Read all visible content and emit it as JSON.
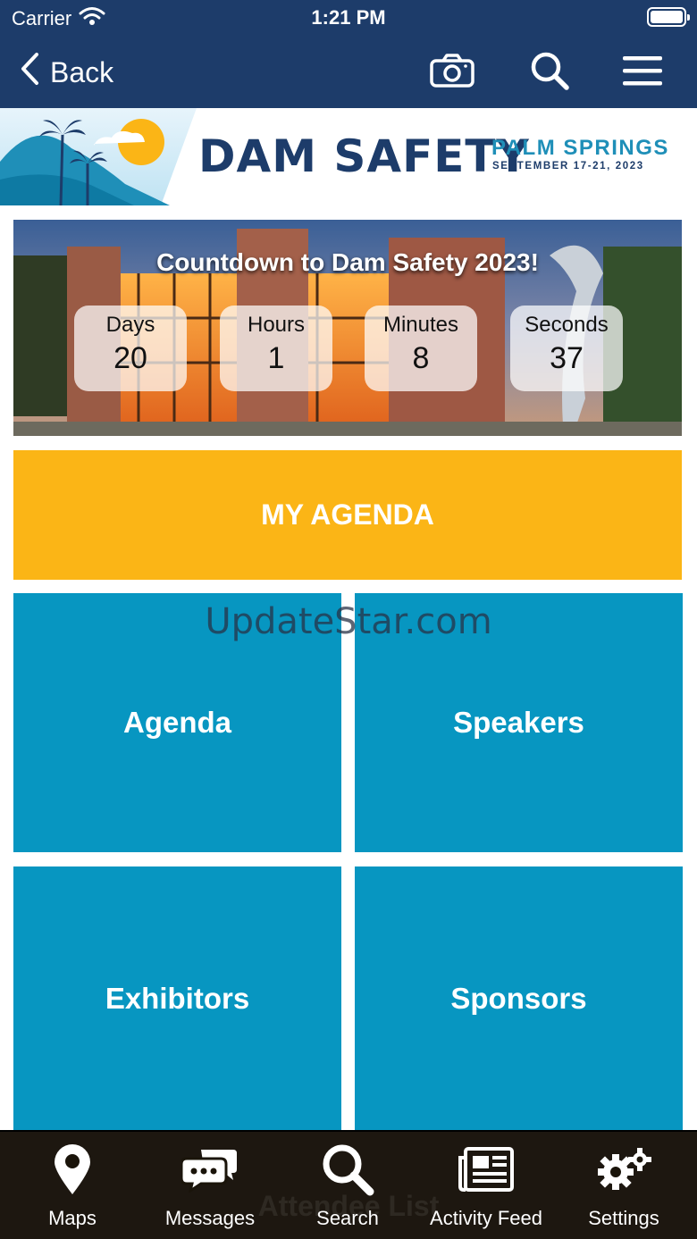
{
  "status_bar": {
    "carrier": "Carrier",
    "time": "1:21 PM"
  },
  "nav": {
    "back_label": "Back",
    "icons": [
      "camera-icon",
      "search-icon",
      "hamburger-menu-icon"
    ]
  },
  "banner": {
    "title": "DAM SAFETY",
    "location": "PALM SPRINGS",
    "dates": "SEPTEMBER 17-21, 2023"
  },
  "countdown": {
    "title": "Countdown to Dam Safety 2023!",
    "units": [
      {
        "label": "Days",
        "value": "20"
      },
      {
        "label": "Hours",
        "value": "1"
      },
      {
        "label": "Minutes",
        "value": "8"
      },
      {
        "label": "Seconds",
        "value": "37"
      }
    ]
  },
  "my_agenda_label": "MY AGENDA",
  "tiles": [
    {
      "label": "Agenda"
    },
    {
      "label": "Speakers"
    },
    {
      "label": "Exhibitors"
    },
    {
      "label": "Sponsors"
    }
  ],
  "watermark": "UpdateStar.com",
  "behind_tabbar_text": "Attendee List",
  "tabbar": [
    {
      "label": "Maps",
      "icon": "map-pin-icon"
    },
    {
      "label": "Messages",
      "icon": "messages-icon"
    },
    {
      "label": "Search",
      "icon": "search-icon"
    },
    {
      "label": "Activity Feed",
      "icon": "newspaper-icon"
    },
    {
      "label": "Settings",
      "icon": "gears-icon"
    }
  ],
  "colors": {
    "navy": "#1d3c6a",
    "agenda_yellow": "#fbb516",
    "tile_blue": "#0796c1",
    "banner_accent": "#1f8fb8"
  }
}
